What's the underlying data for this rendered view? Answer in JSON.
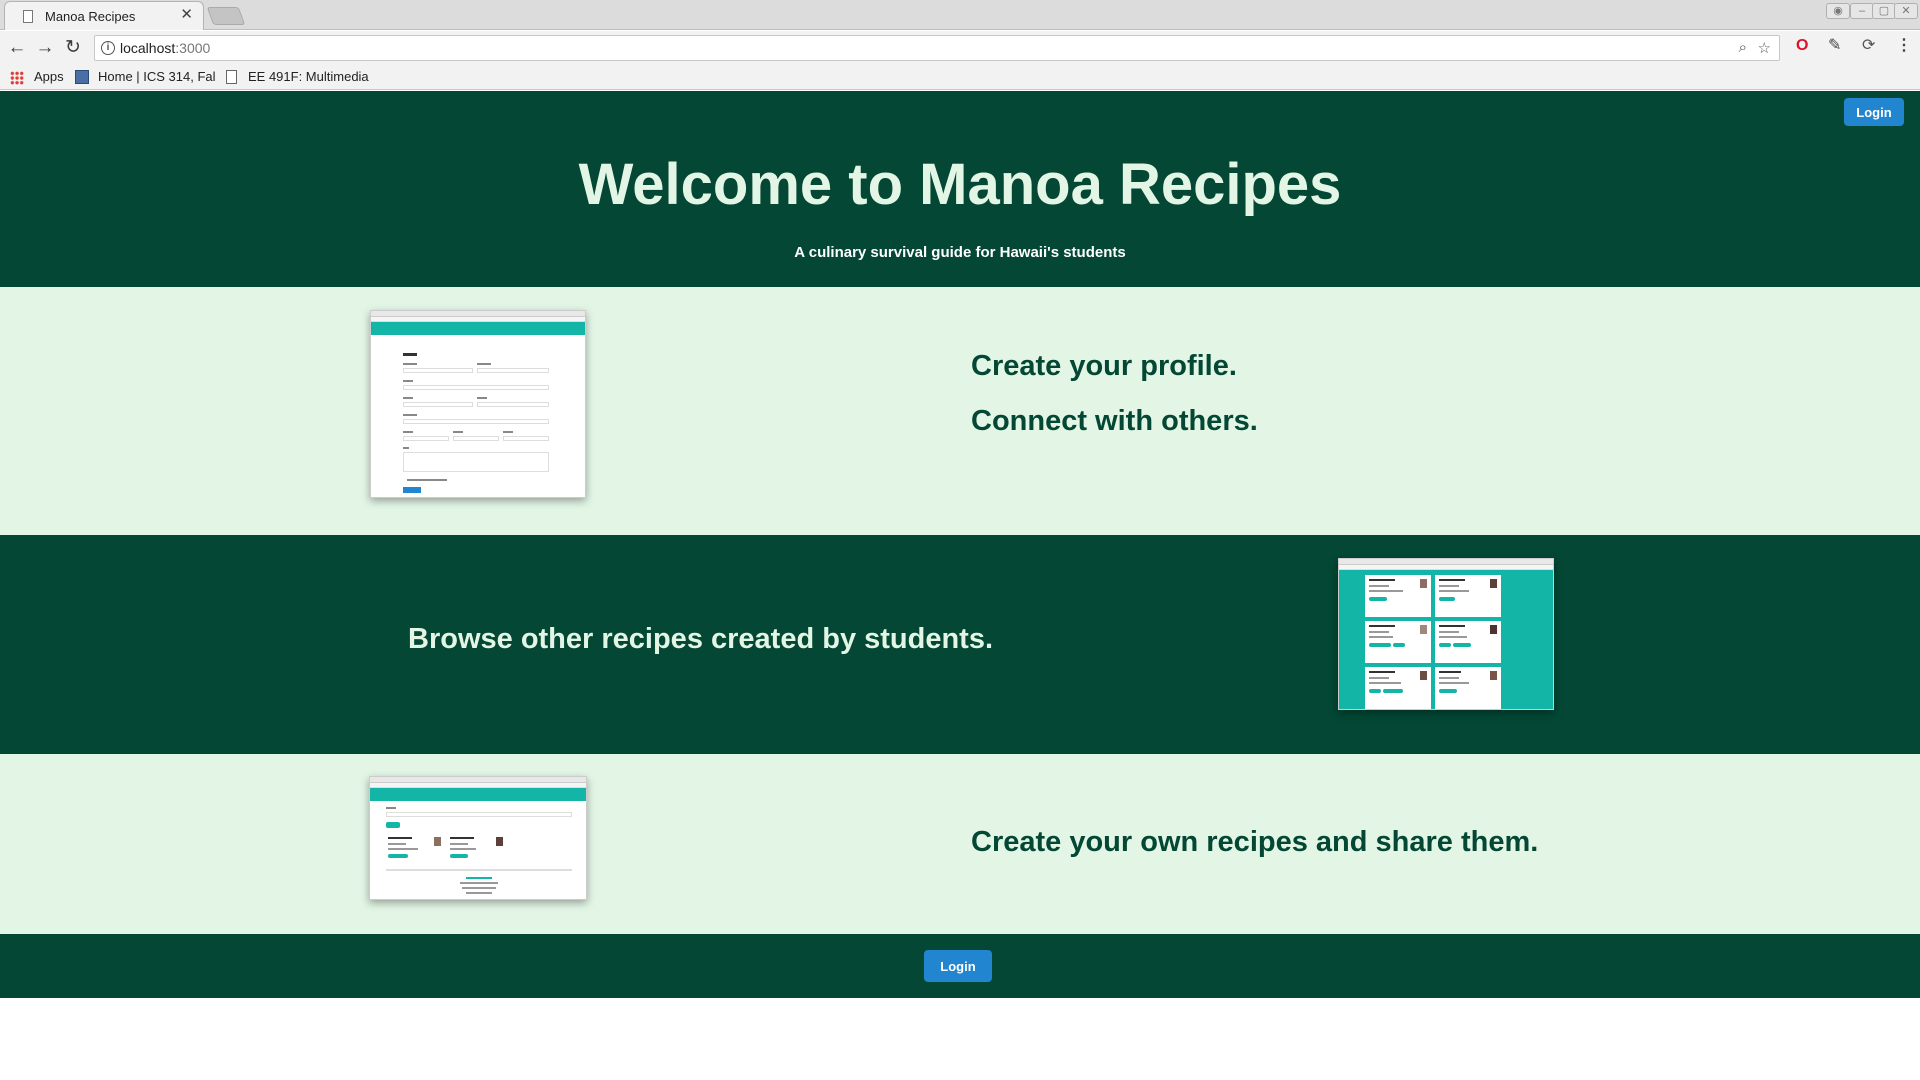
{
  "browser": {
    "tab_title": "Manoa Recipes",
    "url_host": "localhost",
    "url_port": ":3000",
    "bookmarks": [
      "Apps",
      "Home | ICS 314, Fal",
      "EE 491F: Multimedia"
    ]
  },
  "page": {
    "header_login_label": "Login",
    "hero_title": "Welcome to Manoa Recipes",
    "hero_subtitle": "A culinary survival guide for Hawaii's students",
    "feature1_line1": "Create your profile.",
    "feature1_line2": "Connect with others.",
    "feature2_text": "Browse other recipes created by students.",
    "feature3_text": "Create your own recipes and share them.",
    "footer_login_label": "Login"
  },
  "colors": {
    "dark_green": "#034734",
    "light_green": "#e3f6e6",
    "button_blue": "#2185d0",
    "teal": "#13b6a6"
  }
}
